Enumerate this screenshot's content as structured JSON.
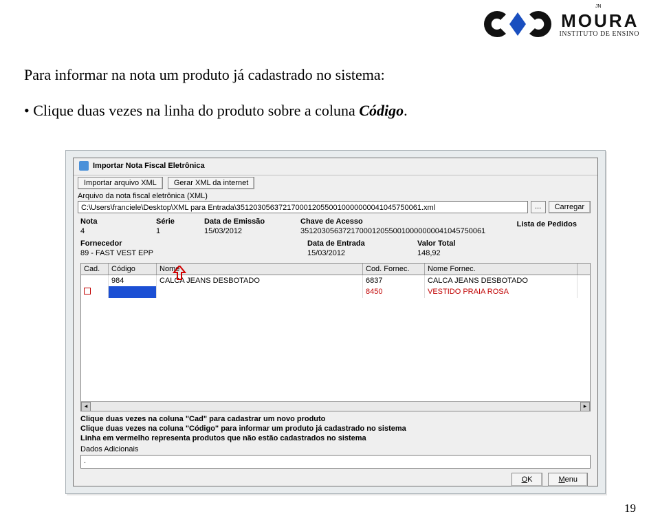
{
  "logo": {
    "brand": "MOURA",
    "sub": "INSTITUTO DE ENSINO",
    "small_tag": "JN"
  },
  "page_title": "Para informar na nota um produto já cadastrado no sistema:",
  "bullet": {
    "prefix": "• Clique duas vezes na linha do produto sobre a coluna ",
    "codigo": "Código",
    "suffix": "."
  },
  "page_number": "19",
  "dialog": {
    "title": "Importar Nota Fiscal Eletrônica",
    "btn_import_xml": "Importar arquivo XML",
    "btn_gerar_xml": "Gerar XML da internet",
    "label_arquivo": "Arquivo da nota fiscal eletrônica (XML)",
    "arquivo_path": "C:\\Users\\franciele\\Desktop\\XML para Entrada\\35120305637217000120550010000000041045750061.xml",
    "btn_browse": "...",
    "btn_carregar": "Carregar",
    "headers": {
      "nota": "Nota",
      "serie": "Série",
      "data_emissao": "Data de Emissão",
      "chave": "Chave de Acesso",
      "fornecedor": "Fornecedor",
      "data_entrada": "Data de Entrada",
      "valor_total": "Valor Total",
      "lista_pedidos": "Lista de Pedidos"
    },
    "values": {
      "nota": "4",
      "serie": "1",
      "data_emissao": "15/03/2012",
      "chave": "35120305637217000120550010000000041045750061",
      "fornecedor": "89 - FAST VEST EPP",
      "data_entrada": "15/03/2012",
      "valor_total": "148,92"
    },
    "table": {
      "cols": {
        "cad": "Cad.",
        "codigo": "Código",
        "nome": "Nome",
        "cod_fornec": "Cod. Fornec.",
        "nome_fornec": "Nome Fornec."
      },
      "rows": [
        {
          "cad": "",
          "codigo": "984",
          "nome": "CALCA JEANS DESBOTADO",
          "cod_fornec": "6837",
          "nome_fornec": "CALCA JEANS DESBOTADO",
          "red": false,
          "selected": false
        },
        {
          "cad": "",
          "codigo": "",
          "nome": "",
          "cod_fornec": "8450",
          "nome_fornec": "VESTIDO PRAIA ROSA",
          "red": true,
          "selected": true
        }
      ]
    },
    "hints": {
      "h1": "Clique duas vezes na coluna \"Cad\" para cadastrar um novo produto",
      "h2": "Clique duas vezes na coluna \"Código\" para informar um produto já cadastrado no sistema",
      "h3": "Linha em vermelho representa produtos que não estão cadastrados no sistema"
    },
    "dados_adicionais_label": "Dados Adicionais",
    "dados_adicionais_value": ".",
    "btn_ok": "OK",
    "btn_menu": "Menu"
  }
}
